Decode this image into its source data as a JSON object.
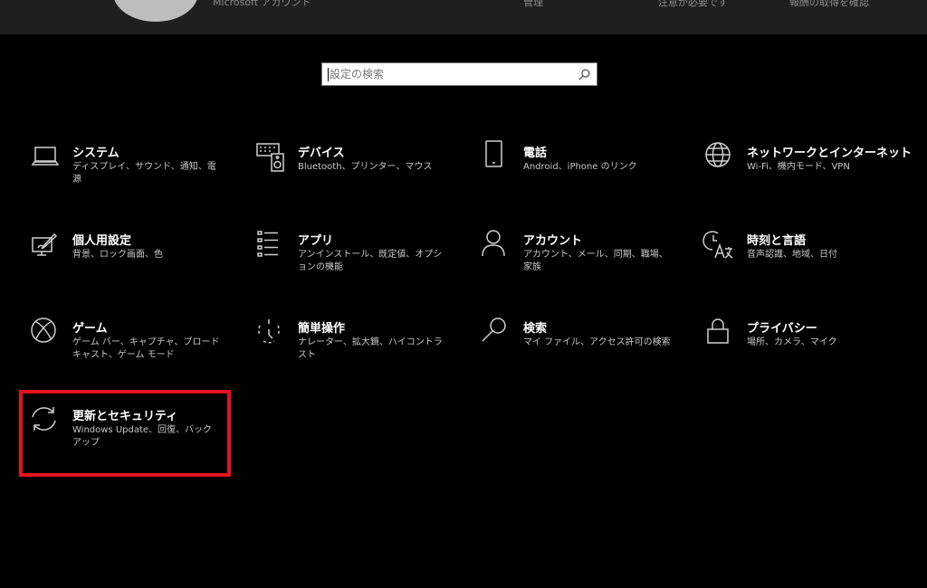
{
  "header": {
    "account_label": "Microsoft アカウント",
    "link_manage": "管理",
    "link_attention": "注意が必要です",
    "link_rewards": "報酬の取得を確認"
  },
  "search": {
    "placeholder": "設定の検索",
    "value": ""
  },
  "categories": [
    {
      "name": "システム",
      "desc": "ディスプレイ、サウンド、通知、電源",
      "icon": "laptop-icon"
    },
    {
      "name": "デバイス",
      "desc": "Bluetooth、プリンター、マウス",
      "icon": "keyboard-speaker-icon"
    },
    {
      "name": "電話",
      "desc": "Android、iPhone のリンク",
      "icon": "phone-icon"
    },
    {
      "name": "ネットワークとインターネット",
      "desc": "Wi-Fi、機内モード、VPN",
      "icon": "globe-icon"
    },
    {
      "name": "個人用設定",
      "desc": "背景、ロック画面、色",
      "icon": "paint-monitor-icon"
    },
    {
      "name": "アプリ",
      "desc": "アンインストール、既定値、オプションの機能",
      "icon": "app-list-icon"
    },
    {
      "name": "アカウント",
      "desc": "アカウント、メール、同期、職場、家族",
      "icon": "person-icon"
    },
    {
      "name": "時刻と言語",
      "desc": "音声認識、地域、日付",
      "icon": "time-language-icon"
    },
    {
      "name": "ゲーム",
      "desc": "ゲーム バー、キャプチャ、ブロードキャスト、ゲーム モード",
      "icon": "xbox-icon"
    },
    {
      "name": "簡単操作",
      "desc": "ナレーター、拡大鏡、ハイコントラスト",
      "icon": "ease-of-access-icon"
    },
    {
      "name": "検索",
      "desc": "マイ ファイル、アクセス許可の検索",
      "icon": "search-icon"
    },
    {
      "name": "プライバシー",
      "desc": "場所、カメラ、マイク",
      "icon": "lock-icon"
    },
    {
      "name": "更新とセキュリティ",
      "desc": "Windows Update、回復、バックアップ",
      "icon": "sync-icon"
    }
  ],
  "colors": {
    "background": "#000000",
    "highlight_border": "#e3131c"
  }
}
